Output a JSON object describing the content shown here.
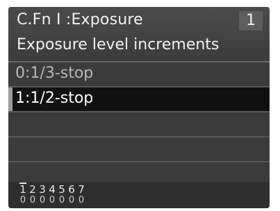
{
  "header": {
    "title": "C.Fn I :Exposure",
    "page_number": "1",
    "subtitle": "Exposure level increments"
  },
  "options": [
    {
      "label": "0:1/3-stop",
      "selected": false
    },
    {
      "label": "1:1/2-stop",
      "selected": true
    }
  ],
  "footer": {
    "function_numbers": [
      "1",
      "2",
      "3",
      "4",
      "5",
      "6",
      "7"
    ],
    "function_values": [
      "0",
      "0",
      "0",
      "0",
      "0",
      "0",
      "0"
    ],
    "active_index": 0
  }
}
